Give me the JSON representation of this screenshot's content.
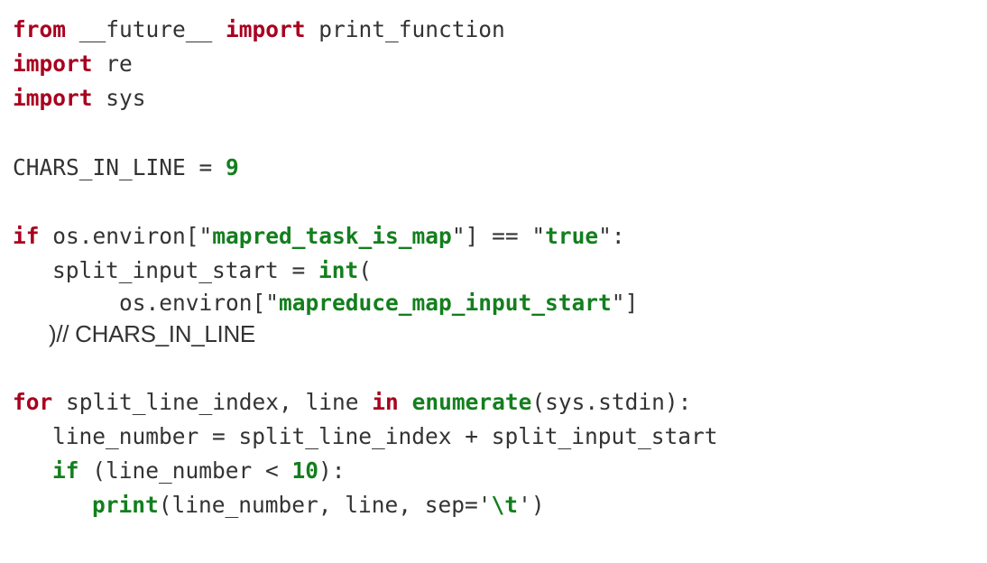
{
  "code": {
    "l1": {
      "kw_from": "from",
      "module": " __future__ ",
      "kw_import": "import",
      "name": " print_function"
    },
    "l2": {
      "kw_import": "import",
      "name": " re"
    },
    "l3": {
      "kw_import": "import",
      "name": " sys"
    },
    "l5": {
      "name": "CHARS_IN_LINE = ",
      "num": "9"
    },
    "l7": {
      "kw_if": "if",
      "pre": " os.environ[",
      "q1": "\"",
      "str": "mapred_task_is_map",
      "q2": "\"",
      "mid": "] == ",
      "q3": "\"",
      "str2": "true",
      "q4": "\"",
      "end": ":"
    },
    "l8": {
      "pre": "split_input_start = ",
      "bi": "int",
      "end": "("
    },
    "l9": {
      "pre": "os.environ[",
      "q1": "\"",
      "str": "mapreduce_map_input_start",
      "q2": "\"",
      "end": "]"
    },
    "l10": {
      "text": ")// CHARS_IN_LINE"
    },
    "l12": {
      "kw_for": "for",
      "pre": " split_line_index, line ",
      "kw_in": "in",
      "sp": " ",
      "bi": "enumerate",
      "end": "(sys.stdin):"
    },
    "l13": {
      "text": "line_number = split_line_index + split_input_start"
    },
    "l14": {
      "kw_if": "if",
      "pre": " (line_number < ",
      "num": "10",
      "end": "):"
    },
    "l15": {
      "bi": "print",
      "pre": "(line_number, line, sep=",
      "q1": "'",
      "esc": "\\t",
      "q2": "'",
      "end": ")"
    }
  }
}
